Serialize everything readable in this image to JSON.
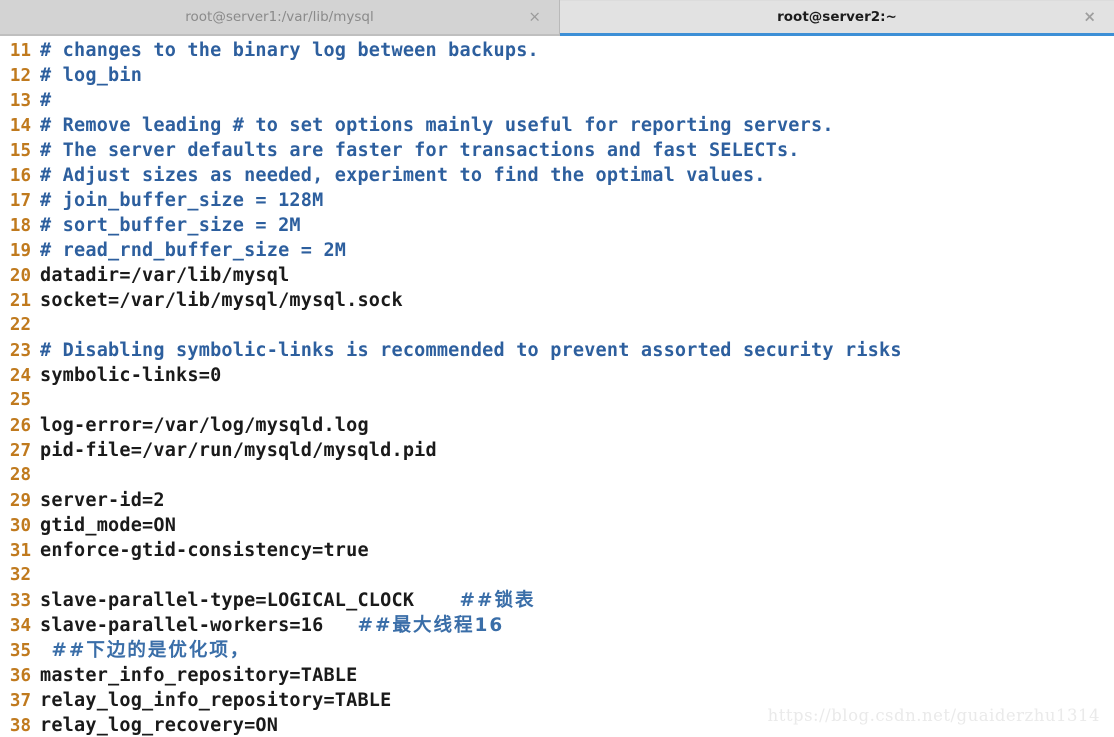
{
  "window": {
    "tabs": [
      {
        "title": "root@server1:/var/lib/mysql",
        "close_label": "×",
        "active": false
      },
      {
        "title": "root@server2:~",
        "close_label": "×",
        "active": true
      }
    ]
  },
  "colors": {
    "line_number": "#c07a1e",
    "comment": "#2d5f9e",
    "code": "#1a1a1a",
    "cn_comment": "#3a6ea8",
    "active_tab_underline": "#3d8fd6",
    "tabbar_bg": "#d3d3d3",
    "active_tab_bg": "#e2e2e2",
    "editor_bg": "#ffffff",
    "watermark": "#eaeaea"
  },
  "editor": {
    "lines": [
      {
        "n": "11",
        "parts": [
          {
            "t": "comment",
            "s": "# changes to the binary log between backups."
          }
        ]
      },
      {
        "n": "12",
        "parts": [
          {
            "t": "comment",
            "s": "# log_bin"
          }
        ]
      },
      {
        "n": "13",
        "parts": [
          {
            "t": "comment",
            "s": "#"
          }
        ]
      },
      {
        "n": "14",
        "parts": [
          {
            "t": "comment",
            "s": "# Remove leading # to set options mainly useful for reporting servers."
          }
        ]
      },
      {
        "n": "15",
        "parts": [
          {
            "t": "comment",
            "s": "# The server defaults are faster for transactions and fast SELECTs."
          }
        ]
      },
      {
        "n": "16",
        "parts": [
          {
            "t": "comment",
            "s": "# Adjust sizes as needed, experiment to find the optimal values."
          }
        ]
      },
      {
        "n": "17",
        "parts": [
          {
            "t": "comment",
            "s": "# join_buffer_size = 128M"
          }
        ]
      },
      {
        "n": "18",
        "parts": [
          {
            "t": "comment",
            "s": "# sort_buffer_size = 2M"
          }
        ]
      },
      {
        "n": "19",
        "parts": [
          {
            "t": "comment",
            "s": "# read_rnd_buffer_size = 2M"
          }
        ]
      },
      {
        "n": "20",
        "parts": [
          {
            "t": "code",
            "s": "datadir=/var/lib/mysql"
          }
        ]
      },
      {
        "n": "21",
        "parts": [
          {
            "t": "code",
            "s": "socket=/var/lib/mysql/mysql.sock"
          }
        ]
      },
      {
        "n": "22",
        "parts": [
          {
            "t": "code",
            "s": ""
          }
        ]
      },
      {
        "n": "23",
        "parts": [
          {
            "t": "comment",
            "s": "# Disabling symbolic-links is recommended to prevent assorted security risks"
          }
        ]
      },
      {
        "n": "24",
        "parts": [
          {
            "t": "code",
            "s": "symbolic-links=0"
          }
        ]
      },
      {
        "n": "25",
        "parts": [
          {
            "t": "code",
            "s": ""
          }
        ]
      },
      {
        "n": "26",
        "parts": [
          {
            "t": "code",
            "s": "log-error=/var/log/mysqld.log"
          }
        ]
      },
      {
        "n": "27",
        "parts": [
          {
            "t": "code",
            "s": "pid-file=/var/run/mysqld/mysqld.pid"
          }
        ]
      },
      {
        "n": "28",
        "parts": [
          {
            "t": "code",
            "s": ""
          }
        ]
      },
      {
        "n": "29",
        "parts": [
          {
            "t": "code",
            "s": "server-id=2"
          }
        ]
      },
      {
        "n": "30",
        "parts": [
          {
            "t": "code",
            "s": "gtid_mode=ON"
          }
        ]
      },
      {
        "n": "31",
        "parts": [
          {
            "t": "code",
            "s": "enforce-gtid-consistency=true"
          }
        ]
      },
      {
        "n": "32",
        "parts": [
          {
            "t": "code",
            "s": ""
          }
        ]
      },
      {
        "n": "33",
        "parts": [
          {
            "t": "code",
            "s": "slave-parallel-type=LOGICAL_CLOCK    "
          },
          {
            "t": "cn",
            "s": "##锁表"
          }
        ]
      },
      {
        "n": "34",
        "parts": [
          {
            "t": "code",
            "s": "slave-parallel-workers=16   "
          },
          {
            "t": "cn",
            "s": "##最大线程16"
          }
        ]
      },
      {
        "n": "35",
        "parts": [
          {
            "t": "code",
            "s": " "
          },
          {
            "t": "cn",
            "s": "##下边的是优化项，"
          }
        ]
      },
      {
        "n": "36",
        "parts": [
          {
            "t": "code",
            "s": "master_info_repository=TABLE"
          }
        ]
      },
      {
        "n": "37",
        "parts": [
          {
            "t": "code",
            "s": "relay_log_info_repository=TABLE"
          }
        ]
      },
      {
        "n": "38",
        "parts": [
          {
            "t": "code",
            "s": "relay_log_recovery=ON"
          }
        ]
      }
    ]
  },
  "watermark": {
    "text": "https://blog.csdn.net/guaiderzhu1314"
  }
}
